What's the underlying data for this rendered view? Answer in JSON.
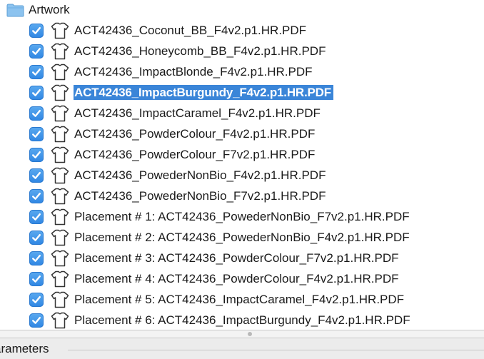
{
  "folder": {
    "label": "Artwork",
    "icon": "folder-icon"
  },
  "colors": {
    "checkbox": "#3a8ee6",
    "selection": "#3a85d8",
    "folder": "#7fb9ea"
  },
  "items": [
    {
      "label": "ACT42436_Coconut_BB_F4v2.p1.HR.PDF",
      "checked": true,
      "selected": false
    },
    {
      "label": "ACT42436_Honeycomb_BB_F4v2.p1.HR.PDF",
      "checked": true,
      "selected": false
    },
    {
      "label": "ACT42436_ImpactBlonde_F4v2.p1.HR.PDF",
      "checked": true,
      "selected": false
    },
    {
      "label": "ACT42436_ImpactBurgundy_F4v2.p1.HR.PDF",
      "checked": true,
      "selected": true
    },
    {
      "label": "ACT42436_ImpactCaramel_F4v2.p1.HR.PDF",
      "checked": true,
      "selected": false
    },
    {
      "label": "ACT42436_PowderColour_F4v2.p1.HR.PDF",
      "checked": true,
      "selected": false
    },
    {
      "label": "ACT42436_PowderColour_F7v2.p1.HR.PDF",
      "checked": true,
      "selected": false
    },
    {
      "label": "ACT42436_PowederNonBio_F4v2.p1.HR.PDF",
      "checked": true,
      "selected": false
    },
    {
      "label": "ACT42436_PowederNonBio_F7v2.p1.HR.PDF",
      "checked": true,
      "selected": false
    },
    {
      "label": "Placement # 1: ACT42436_PowederNonBio_F7v2.p1.HR.PDF",
      "checked": true,
      "selected": false
    },
    {
      "label": "Placement # 2: ACT42436_PowederNonBio_F4v2.p1.HR.PDF",
      "checked": true,
      "selected": false
    },
    {
      "label": "Placement # 3: ACT42436_PowderColour_F7v2.p1.HR.PDF",
      "checked": true,
      "selected": false
    },
    {
      "label": "Placement # 4: ACT42436_PowderColour_F4v2.p1.HR.PDF",
      "checked": true,
      "selected": false
    },
    {
      "label": "Placement # 5: ACT42436_ImpactCaramel_F4v2.p1.HR.PDF",
      "checked": true,
      "selected": false
    },
    {
      "label": "Placement # 6: ACT42436_ImpactBurgundy_F4v2.p1.HR.PDF",
      "checked": true,
      "selected": false
    }
  ],
  "parameters": {
    "label": "arameters"
  }
}
